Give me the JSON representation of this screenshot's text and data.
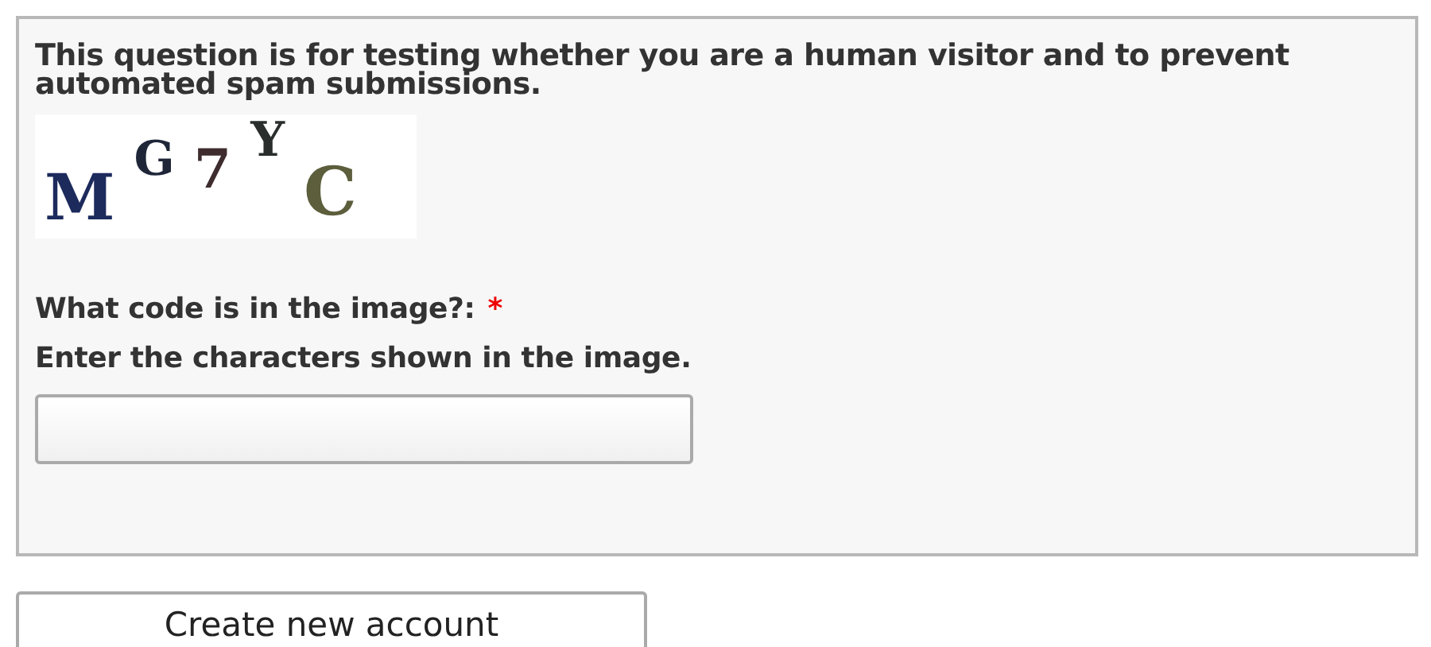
{
  "captcha_fieldset": {
    "description": "This question is for testing whether you are a human visitor and to prevent automated spam submissions.",
    "captcha_image": [
      {
        "char": "M",
        "color": "#1c2a5c"
      },
      {
        "char": "G",
        "color": "#1e2638"
      },
      {
        "char": "7",
        "color": "#3e2c2e"
      },
      {
        "char": "Y",
        "color": "#2a2e2c"
      },
      {
        "char": "C",
        "color": "#5c5e3c"
      }
    ],
    "field": {
      "label": "What code is in the image?:",
      "required_mark": "*",
      "description": "Enter the characters shown in the image."
    }
  },
  "submit_button": {
    "label": "Create new account"
  }
}
